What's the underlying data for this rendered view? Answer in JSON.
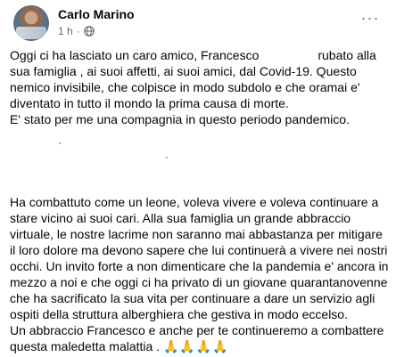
{
  "post": {
    "author": "Carlo Marino",
    "time": "1 h",
    "separator": "·",
    "audience_icon": "globe-icon",
    "more_icon": "more-options-icon",
    "more_label": "···",
    "paragraph1": {
      "part1": "Oggi ci ha lasciato un caro amico, Francesco",
      "part2": "rubato alla sua famiglia , ai suoi affetti, ai suoi amici, dal Covid-19. Questo nemico invisibile, che colpisce in modo subdolo e che oramai e' diventato in tutto il mondo la prima causa di morte.",
      "line2": "E' stato per me una compagnia in questo periodo pandemico."
    },
    "paragraph2": "Ha combattuto come un leone, voleva vivere e voleva continuare a stare vicino ai suoi cari. Alla sua famiglia un grande abbraccio virtuale, le nostre lacrime non saranno mai abbastanza per mitigare il loro dolore ma devono sapere che lui continuerà a vivere nei nostri occhi. Un invito forte a non dimenticare che la pandemia e' ancora in mezzo a noi e che oggi ci ha privato di un giovane quarantanovenne che ha sacrificato la sua vita per continuare a dare un servizio agli ospiti della struttura alberghiera che gestiva in modo eccelso.",
    "paragraph3": "Un abbraccio Francesco e anche per te continueremo a combattere questa maledetta malattia .",
    "emoji": "🙏🙏🙏🙏",
    "colors": {
      "text": "#050505",
      "secondary": "#65676b",
      "background": "#ffffff"
    }
  }
}
